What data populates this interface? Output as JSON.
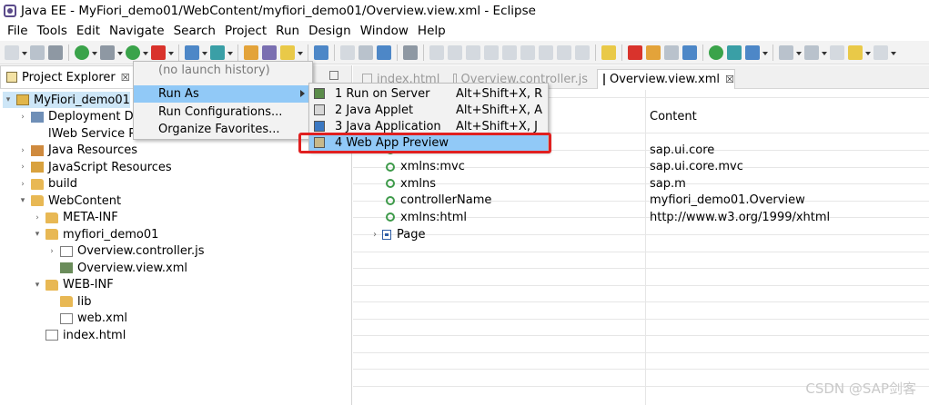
{
  "window": {
    "title": "Java EE - MyFiori_demo01/WebContent/myfiori_demo01/Overview.view.xml - Eclipse"
  },
  "menubar": [
    "File",
    "Tools",
    "Edit",
    "Navigate",
    "Search",
    "Project",
    "Run",
    "Design",
    "Window",
    "Help"
  ],
  "explorer": {
    "tab_label": "Project Explorer",
    "close": "☒",
    "tree": [
      {
        "label": "MyFiori_demo01",
        "twisty": "▾",
        "icon": "proj",
        "depth": 0,
        "selected": true
      },
      {
        "label": "Deployment De",
        "twisty": "›",
        "icon": "depl",
        "depth": 1
      },
      {
        "label": "lWeb Service Pr",
        "twisty": "",
        "icon": "websvc",
        "depth": 1
      },
      {
        "label": "Java Resources",
        "twisty": "›",
        "icon": "jres",
        "depth": 1
      },
      {
        "label": "JavaScript Resources",
        "twisty": "›",
        "icon": "jsres",
        "depth": 1
      },
      {
        "label": "build",
        "twisty": "›",
        "icon": "folder",
        "depth": 1
      },
      {
        "label": "WebContent",
        "twisty": "▾",
        "icon": "folder",
        "depth": 1
      },
      {
        "label": "META-INF",
        "twisty": "›",
        "icon": "folder",
        "depth": 2
      },
      {
        "label": "myfiori_demo01",
        "twisty": "▾",
        "icon": "folder",
        "depth": 2
      },
      {
        "label": "Overview.controller.js",
        "twisty": "›",
        "icon": "jsfile",
        "depth": 3
      },
      {
        "label": "Overview.view.xml",
        "twisty": "",
        "icon": "xmlfile",
        "depth": 3
      },
      {
        "label": "WEB-INF",
        "twisty": "▾",
        "icon": "folder",
        "depth": 2
      },
      {
        "label": "lib",
        "twisty": "",
        "icon": "folder",
        "depth": 3
      },
      {
        "label": "web.xml",
        "twisty": "",
        "icon": "jsfile",
        "depth": 3
      },
      {
        "label": "index.html",
        "twisty": "",
        "icon": "jsfile",
        "depth": 2
      }
    ]
  },
  "editor": {
    "tabs": [
      {
        "label": "index.html",
        "active": false
      },
      {
        "label": "Overview.controller.js",
        "active": false
      },
      {
        "label": "Overview.view.xml",
        "active": true,
        "close": "☒"
      }
    ],
    "column_header": "Content",
    "rows": [
      {
        "node": "xmlns",
        "value": "sap.ui.core",
        "kind": "attr",
        "partial": true
      },
      {
        "node": "xmlns:mvc",
        "value": "sap.ui.core.mvc",
        "kind": "attr"
      },
      {
        "node": "xmlns",
        "value": "sap.m",
        "kind": "attr"
      },
      {
        "node": "controllerName",
        "value": "myfiori_demo01.Overview",
        "kind": "attr"
      },
      {
        "node": "xmlns:html",
        "value": "http://www.w3.org/1999/xhtml",
        "kind": "attr"
      },
      {
        "node": "Page",
        "value": "",
        "kind": "element"
      }
    ]
  },
  "context_menu": {
    "items": [
      {
        "label": "(no launch history)",
        "disabled": true
      },
      {
        "label": "Run As",
        "highlighted": true,
        "submenu": true
      },
      {
        "label": "Run Configurations..."
      },
      {
        "label": "Organize Favorites..."
      }
    ]
  },
  "run_as_menu": {
    "items": [
      {
        "label": "1 Run on Server",
        "shortcut": "Alt+Shift+X, R"
      },
      {
        "label": "2 Java Applet",
        "shortcut": "Alt+Shift+X, A"
      },
      {
        "label": "3 Java Application",
        "shortcut": "Alt+Shift+X, J"
      },
      {
        "label": "4 Web App Preview",
        "shortcut": "",
        "highlighted": true
      }
    ]
  },
  "watermark": "CSDN @SAP剑客",
  "colors": {
    "selection": "#cde6f7",
    "menu_highlight": "#91c9f7",
    "callout": "#e02020"
  }
}
